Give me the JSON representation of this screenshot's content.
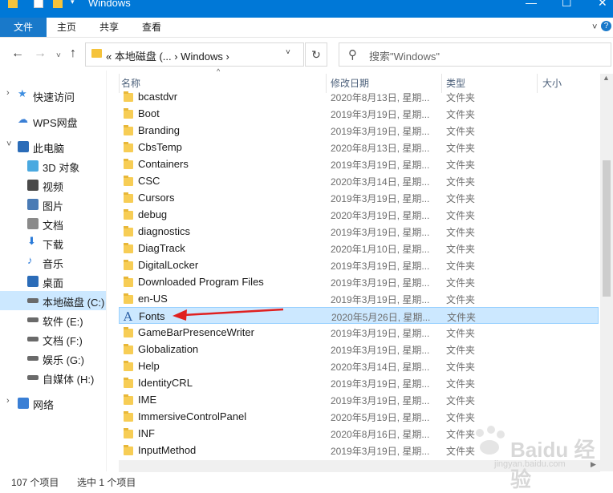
{
  "window": {
    "title": "Windows",
    "controls": {
      "minimize": "—",
      "maximize": "☐",
      "close": "✕"
    }
  },
  "ribbon": {
    "tabs": [
      "文件",
      "主页",
      "共享",
      "查看"
    ],
    "expand_glyph": "˅",
    "help_glyph": "?"
  },
  "nav": {
    "back_glyph": "←",
    "forward_glyph": "→",
    "recent_glyph": "˅",
    "up_glyph": "↑",
    "address_path": "« 本地磁盘 (... › Windows ›",
    "address_dropdown": "˅",
    "refresh_glyph": "↻",
    "search_placeholder": "搜索\"Windows\""
  },
  "sidebar": {
    "items": [
      {
        "label": "快速访问",
        "icon": "star-icon"
      },
      {
        "label": "WPS网盘",
        "icon": "cloud-icon"
      },
      {
        "label": "此电脑",
        "icon": "pc-icon"
      },
      {
        "label": "3D 对象",
        "icon": "cube-icon"
      },
      {
        "label": "视频",
        "icon": "video-icon"
      },
      {
        "label": "图片",
        "icon": "picture-icon"
      },
      {
        "label": "文档",
        "icon": "document-icon"
      },
      {
        "label": "下载",
        "icon": "download-icon"
      },
      {
        "label": "音乐",
        "icon": "music-icon"
      },
      {
        "label": "桌面",
        "icon": "desktop-icon"
      },
      {
        "label": "本地磁盘 (C:)",
        "icon": "drive-icon"
      },
      {
        "label": "软件 (E:)",
        "icon": "drive-icon"
      },
      {
        "label": "文档 (F:)",
        "icon": "drive-icon"
      },
      {
        "label": "娱乐 (G:)",
        "icon": "drive-icon"
      },
      {
        "label": "自媒体 (H:)",
        "icon": "drive-icon"
      },
      {
        "label": "网络",
        "icon": "network-icon"
      }
    ]
  },
  "columns": {
    "name": "名称",
    "date": "修改日期",
    "type": "类型",
    "size": "大小",
    "sort_glyph": "^"
  },
  "files": [
    {
      "name": "bcastdvr",
      "date": "2020年8月13日, 星期...",
      "type": "文件夹",
      "icon": "folder-icon"
    },
    {
      "name": "Boot",
      "date": "2019年3月19日, 星期...",
      "type": "文件夹",
      "icon": "folder-icon"
    },
    {
      "name": "Branding",
      "date": "2019年3月19日, 星期...",
      "type": "文件夹",
      "icon": "folder-icon"
    },
    {
      "name": "CbsTemp",
      "date": "2020年8月13日, 星期...",
      "type": "文件夹",
      "icon": "folder-icon"
    },
    {
      "name": "Containers",
      "date": "2019年3月19日, 星期...",
      "type": "文件夹",
      "icon": "folder-icon"
    },
    {
      "name": "CSC",
      "date": "2020年3月14日, 星期...",
      "type": "文件夹",
      "icon": "folder-icon"
    },
    {
      "name": "Cursors",
      "date": "2019年3月19日, 星期...",
      "type": "文件夹",
      "icon": "folder-icon"
    },
    {
      "name": "debug",
      "date": "2020年3月19日, 星期...",
      "type": "文件夹",
      "icon": "folder-icon"
    },
    {
      "name": "diagnostics",
      "date": "2019年3月19日, 星期...",
      "type": "文件夹",
      "icon": "folder-icon"
    },
    {
      "name": "DiagTrack",
      "date": "2020年1月10日, 星期...",
      "type": "文件夹",
      "icon": "folder-icon"
    },
    {
      "name": "DigitalLocker",
      "date": "2019年3月19日, 星期...",
      "type": "文件夹",
      "icon": "folder-icon"
    },
    {
      "name": "Downloaded Program Files",
      "date": "2019年3月19日, 星期...",
      "type": "文件夹",
      "icon": "folder-icon"
    },
    {
      "name": "en-US",
      "date": "2019年3月19日, 星期...",
      "type": "文件夹",
      "icon": "folder-icon"
    },
    {
      "name": "Fonts",
      "date": "2020年5月26日, 星期...",
      "type": "文件夹",
      "icon": "font-folder-icon",
      "selected": true
    },
    {
      "name": "GameBarPresenceWriter",
      "date": "2019年3月19日, 星期...",
      "type": "文件夹",
      "icon": "folder-icon"
    },
    {
      "name": "Globalization",
      "date": "2019年3月19日, 星期...",
      "type": "文件夹",
      "icon": "folder-icon"
    },
    {
      "name": "Help",
      "date": "2020年3月14日, 星期...",
      "type": "文件夹",
      "icon": "folder-icon"
    },
    {
      "name": "IdentityCRL",
      "date": "2019年3月19日, 星期...",
      "type": "文件夹",
      "icon": "folder-icon"
    },
    {
      "name": "IME",
      "date": "2019年3月19日, 星期...",
      "type": "文件夹",
      "icon": "folder-icon"
    },
    {
      "name": "ImmersiveControlPanel",
      "date": "2020年5月19日, 星期...",
      "type": "文件夹",
      "icon": "folder-icon"
    },
    {
      "name": "INF",
      "date": "2020年8月16日, 星期...",
      "type": "文件夹",
      "icon": "folder-icon"
    },
    {
      "name": "InputMethod",
      "date": "2019年3月19日, 星期...",
      "type": "文件夹",
      "icon": "folder-icon"
    }
  ],
  "status": {
    "count": "107 个项目",
    "selection": "选中 1 个项目"
  },
  "watermark": {
    "text": "Baidu 经验",
    "sub": "jingyan.baidu.com"
  },
  "colors": {
    "accent": "#0078d7",
    "selection": "#cce8ff",
    "folder": "#f7cd55",
    "annotation": "#e02020"
  }
}
